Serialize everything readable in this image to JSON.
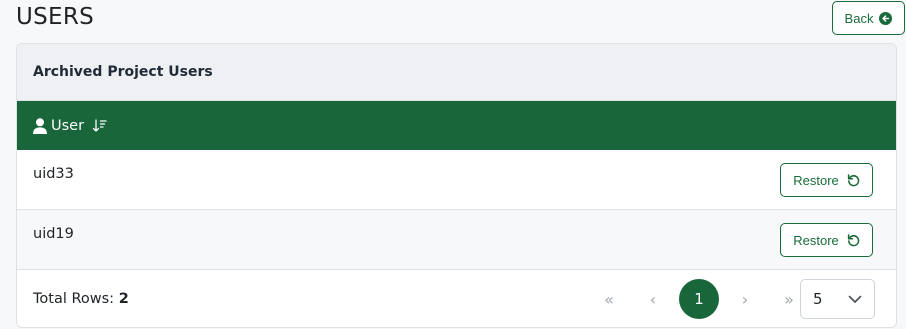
{
  "page": {
    "title": "USERS"
  },
  "header": {
    "back_label": "Back"
  },
  "card": {
    "title": "Archived Project Users"
  },
  "table": {
    "column": "User",
    "rows": [
      {
        "uid": "uid33",
        "action": "Restore"
      },
      {
        "uid": "uid19",
        "action": "Restore"
      }
    ]
  },
  "footer": {
    "total_label": "Total Rows:",
    "total_value": "2",
    "pagination": {
      "first": "«",
      "prev": "‹",
      "current": "1",
      "next": "›",
      "last": "»"
    },
    "page_size": "5"
  },
  "colors": {
    "accent": "#186639",
    "header_bg": "#eef0f4"
  }
}
